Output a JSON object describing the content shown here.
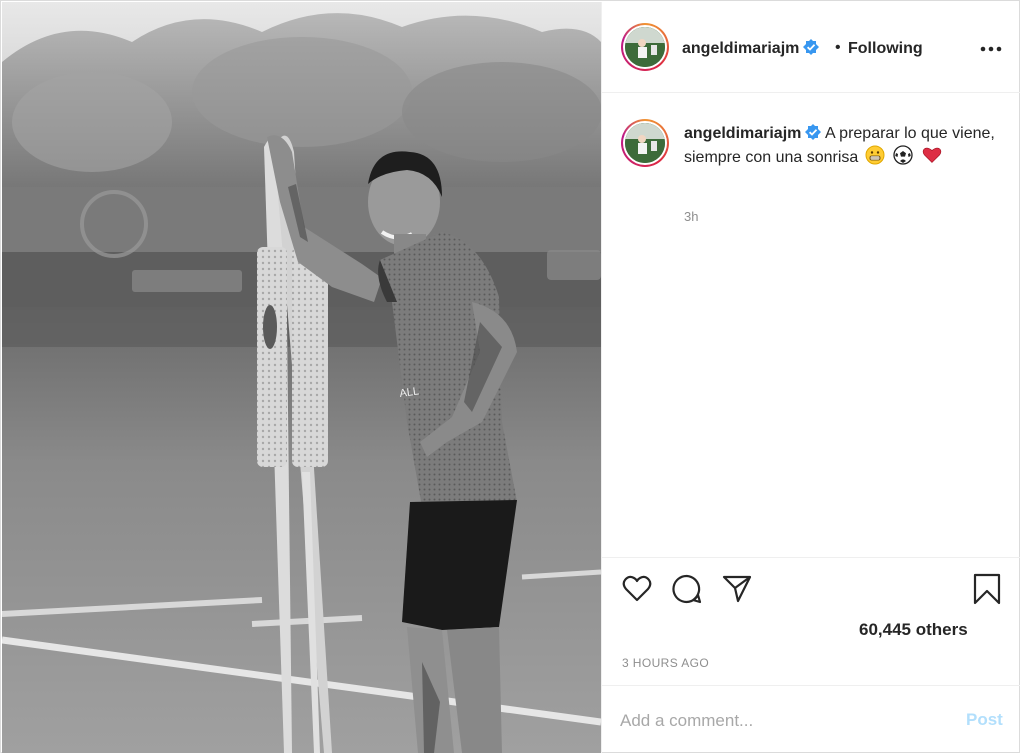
{
  "post": {
    "username": "angeldimariajm",
    "verified": true,
    "separator": "•",
    "follow_status": "Following",
    "caption_text": "A preparar lo que viene, siempre con una sonrisa",
    "caption_emojis": [
      "grinning-face-emoji",
      "soccer-ball-emoji",
      "red-heart-emoji"
    ],
    "caption_time": "3h",
    "likes_text": "60,445 others",
    "timestamp": "3 HOURS AGO"
  },
  "comment_box": {
    "placeholder": "Add a comment...",
    "post_label": "Post"
  },
  "icons": {
    "like": "heart-icon",
    "comment": "speech-bubble-icon",
    "share": "paper-plane-icon",
    "save": "bookmark-icon",
    "more": "ellipsis-icon",
    "verified": "verified-badge-icon"
  },
  "colors": {
    "verified_blue": "#3897f0",
    "post_button_disabled": "#b2dffc",
    "muted_text": "#8e8e8e"
  }
}
